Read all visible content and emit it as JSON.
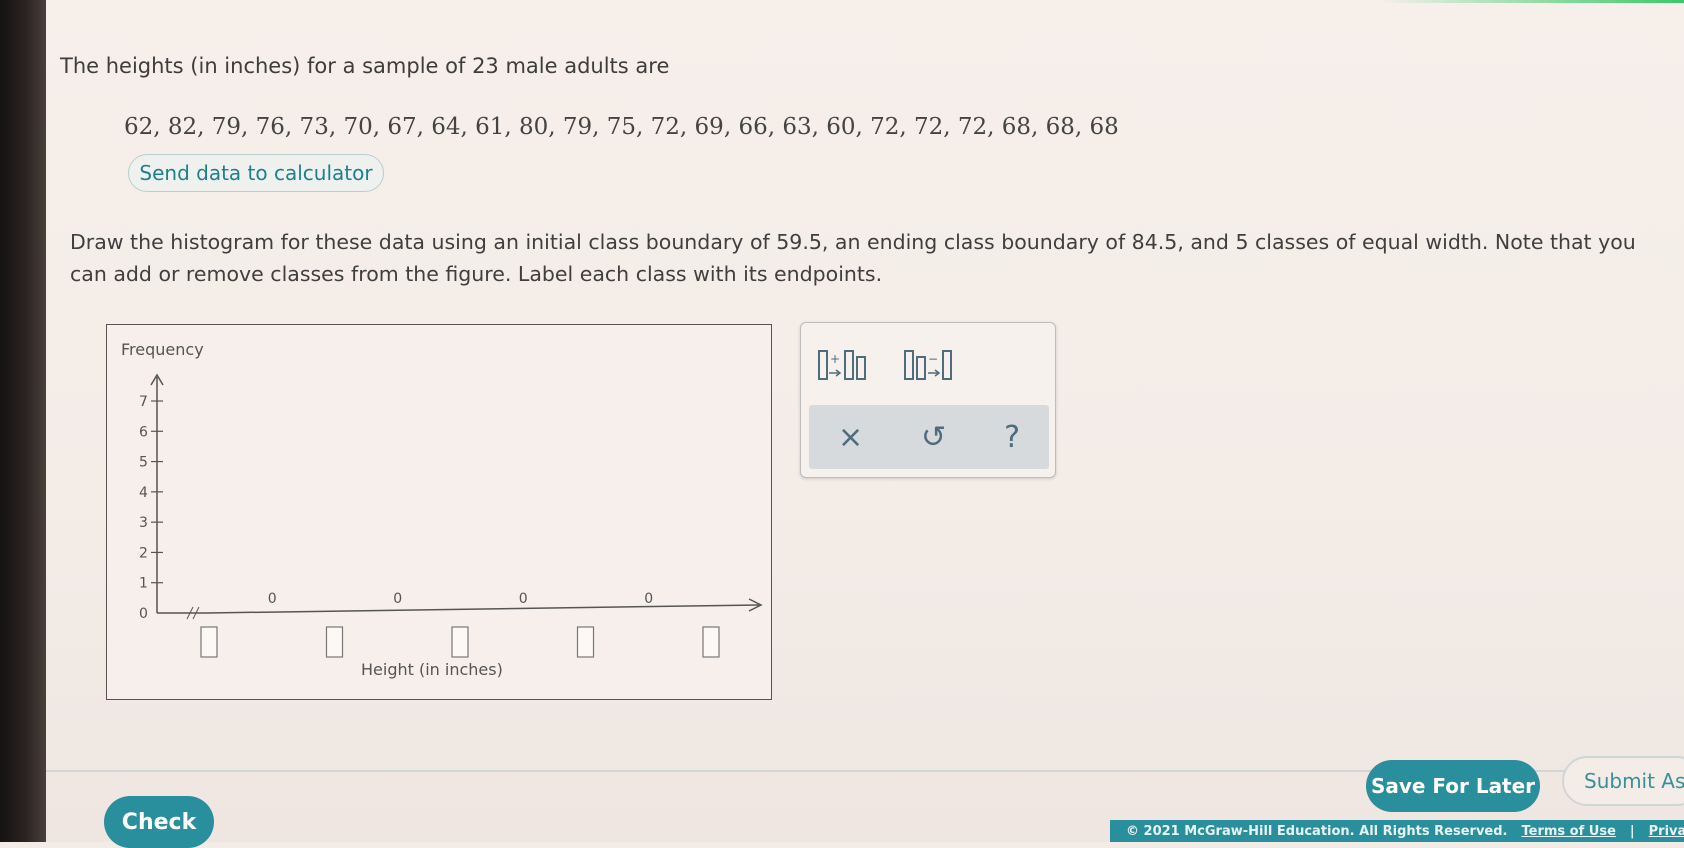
{
  "problem": {
    "intro": "The heights (in inches) for a sample of 23 male adults are",
    "data_values": "62, 82, 79, 76, 73, 70, 67, 64, 61, 80, 79, 75, 72, 69, 66, 63, 60, 72, 72, 72, 68, 68, 68",
    "send_button": "Send data to calculator",
    "instructions": "Draw the histogram for these data using an initial class boundary of 59.5, an ending class boundary of 84.5, and 5 classes of equal width. Note that you can add or remove classes from the figure. Label each class with its endpoints."
  },
  "graph": {
    "ylabel": "Frequency",
    "xlabel": "Height (in inches)",
    "y_ticks": [
      "0",
      "1",
      "2",
      "3",
      "4",
      "5",
      "6",
      "7"
    ],
    "bar_counts": [
      "0",
      "0",
      "0",
      "0"
    ],
    "accent_color": "#555555"
  },
  "chart_data": {
    "type": "bar",
    "title": "",
    "xlabel": "Height (in inches)",
    "ylabel": "Frequency",
    "categories": [
      "",
      "",
      "",
      ""
    ],
    "values": [
      0,
      0,
      0,
      0
    ],
    "ylim": [
      0,
      7
    ],
    "grid": false
  },
  "tools": {
    "add_class_icon": "add-class-icon",
    "remove_class_icon": "remove-class-icon",
    "clear_symbol": "×",
    "undo_symbol": "↺",
    "help_symbol": "?"
  },
  "footer": {
    "check": "Check",
    "save": "Save For Later",
    "submit": "Submit Ass",
    "copyright": "© 2021 McGraw-Hill Education. All Rights Reserved.",
    "terms": "Terms of Use",
    "privacy": "Privacy",
    "brand_color": "#2a8f9c"
  }
}
